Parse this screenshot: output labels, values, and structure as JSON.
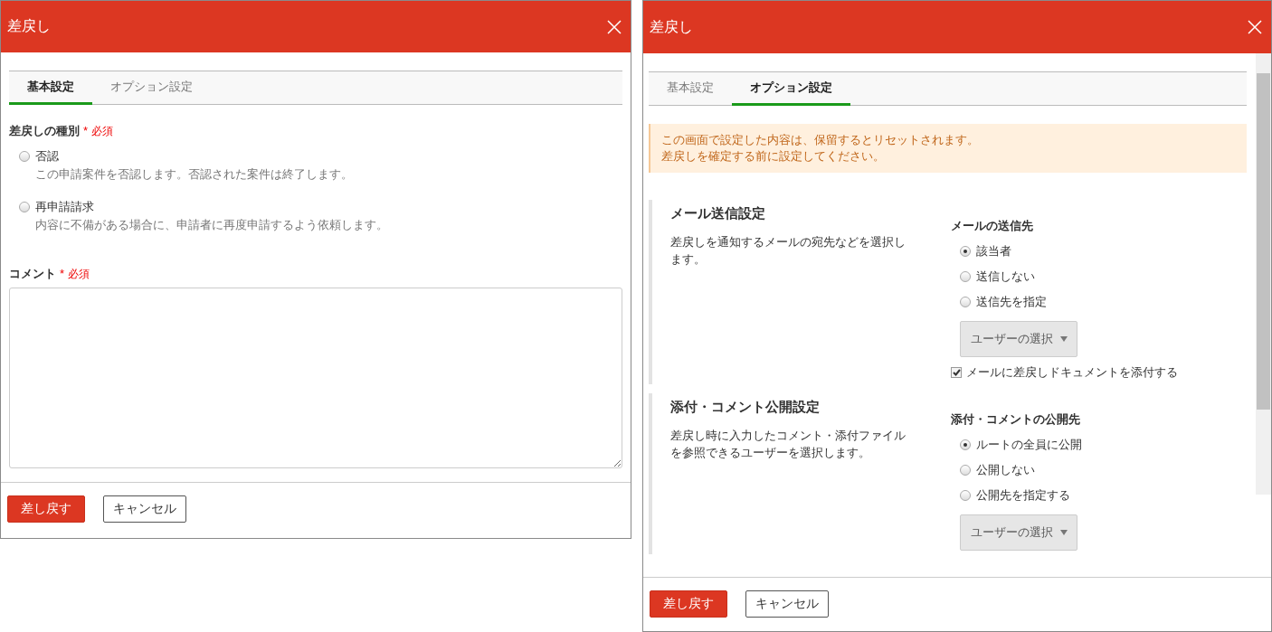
{
  "dialogs": [
    {
      "kind": "basic",
      "title": "差戻し",
      "tabs": [
        {
          "label": "基本設定",
          "selected": true
        },
        {
          "label": "オプション設定",
          "selected": false
        }
      ],
      "type_field": {
        "label": "差戻しの種別",
        "required_mark": "*",
        "required": "必須",
        "options": [
          {
            "label": "否認",
            "description": "この申請案件を否認します。否認された案件は終了します。",
            "selected": false
          },
          {
            "label": "再申請請求",
            "description": "内容に不備がある場合に、申請者に再度申請するよう依頼します。",
            "selected": false
          }
        ]
      },
      "comment": {
        "label": "コメント",
        "required_mark": "*",
        "required": "必須"
      },
      "buttons": {
        "submit": "差し戻す",
        "cancel": "キャンセル"
      }
    },
    {
      "kind": "options",
      "title": "差戻し",
      "tabs": [
        {
          "label": "基本設定",
          "selected": false
        },
        {
          "label": "オプション設定",
          "selected": true
        }
      ],
      "notice": [
        "この画面で設定した内容は、保留するとリセットされます。",
        "差戻しを確定する前に設定してください。"
      ],
      "sections": [
        {
          "title": "メール送信設定",
          "description": "差戻しを通知するメールの宛先などを選択します。",
          "field_label": "メールの送信先",
          "options": [
            {
              "label": "該当者",
              "selected": true
            },
            {
              "label": "送信しない",
              "selected": false
            },
            {
              "label": "送信先を指定",
              "selected": false
            }
          ],
          "user_select": "ユーザーの選択",
          "attach": {
            "label": "メールに差戻しドキュメントを添付する",
            "checked": true
          }
        },
        {
          "title": "添付・コメント公開設定",
          "description": "差戻し時に入力したコメント・添付ファイルを参照できるユーザーを選択します。",
          "field_label": "添付・コメントの公開先",
          "options": [
            {
              "label": "ルートの全員に公開",
              "selected": true
            },
            {
              "label": "公開しない",
              "selected": false
            },
            {
              "label": "公開先を指定する",
              "selected": false
            }
          ],
          "user_select": "ユーザーの選択"
        }
      ],
      "buttons": {
        "submit": "差し戻す",
        "cancel": "キャンセル"
      }
    }
  ]
}
